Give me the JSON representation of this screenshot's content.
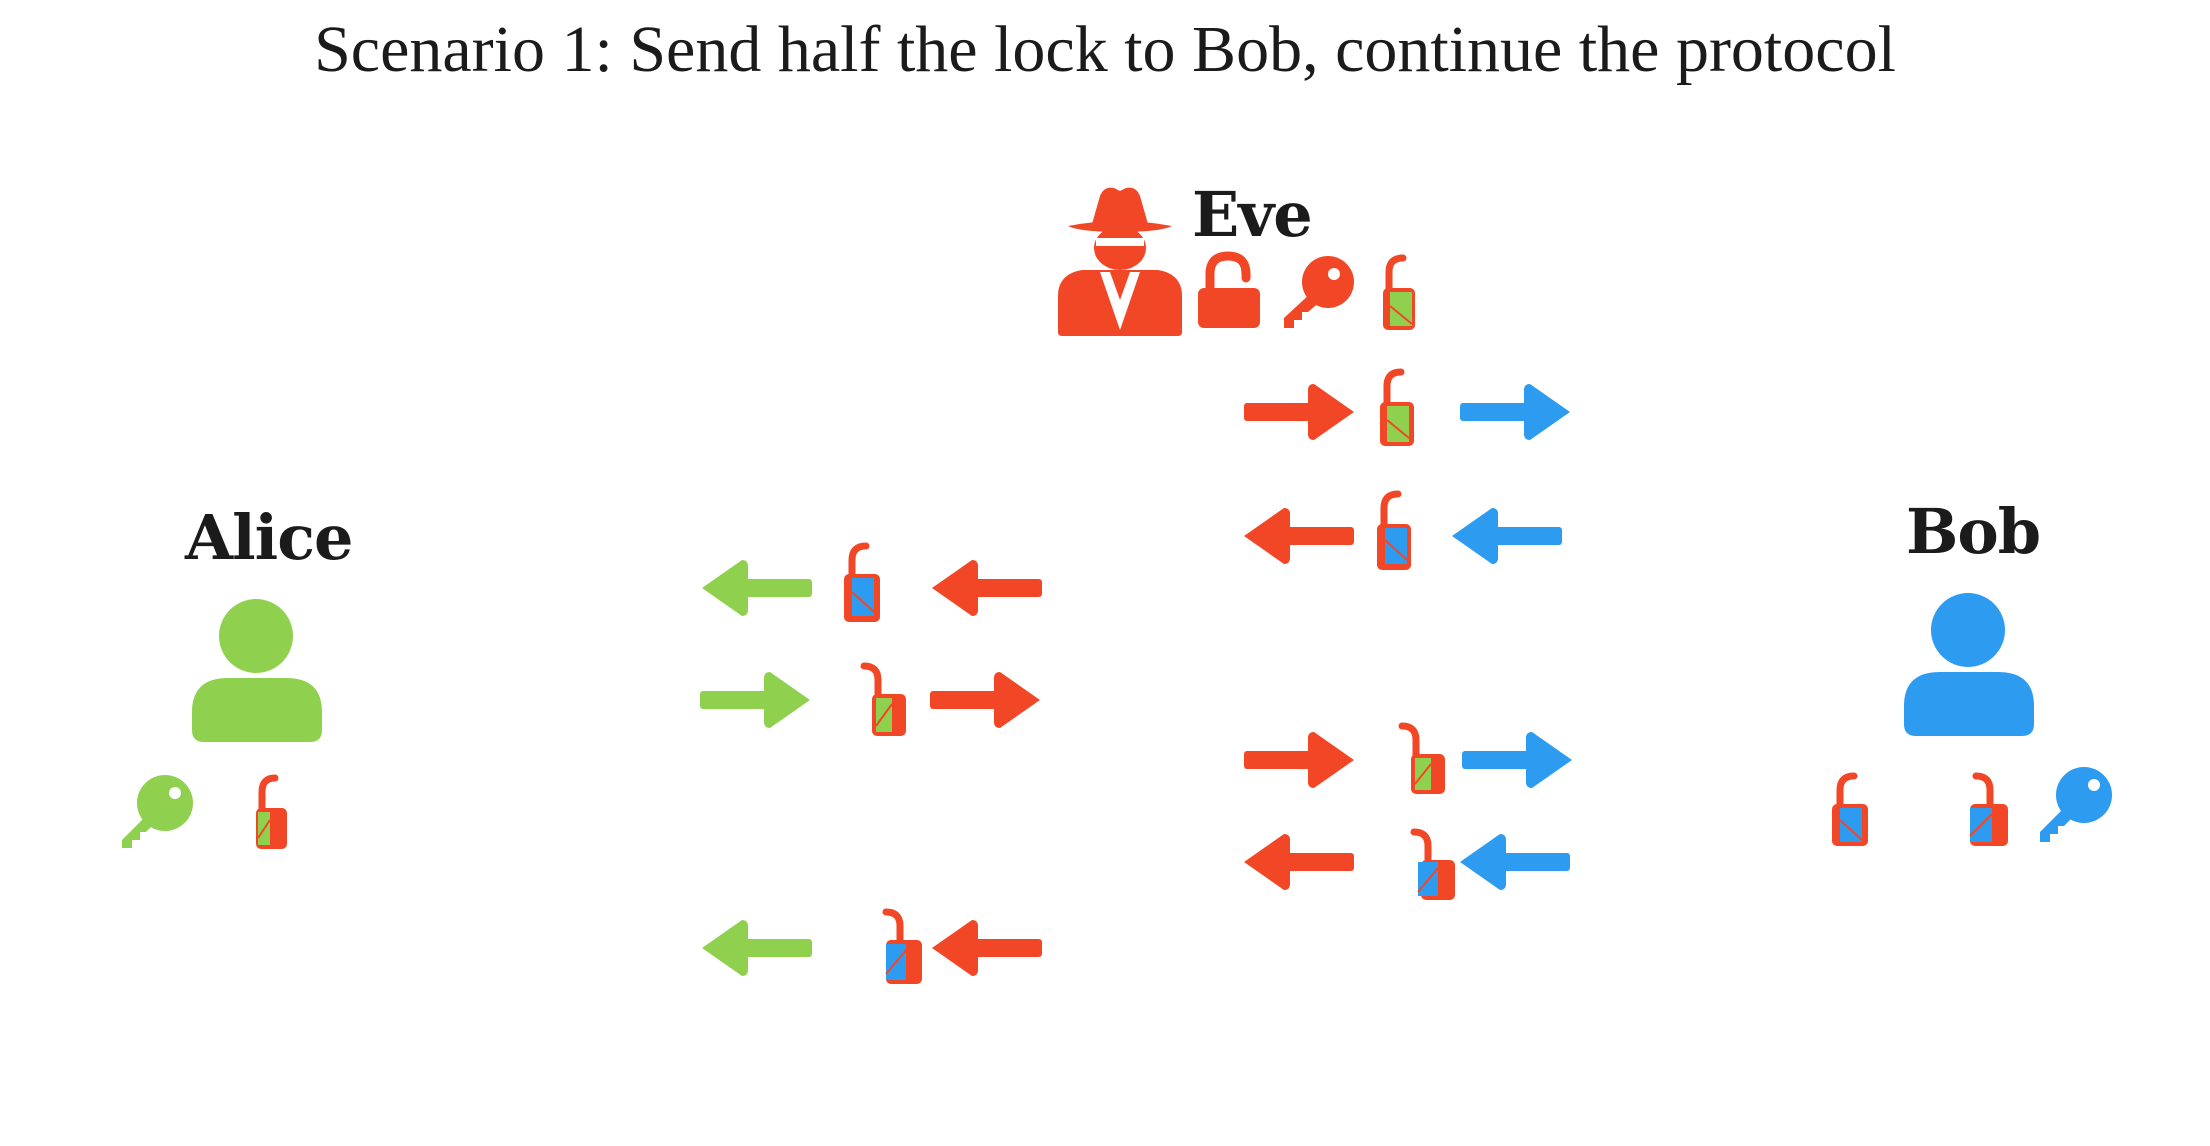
{
  "title": "Scenario 1: Send half the lock to Bob, continue the protocol",
  "actors": {
    "alice": {
      "name": "Alice"
    },
    "eve": {
      "name": "Eve"
    },
    "bob": {
      "name": "Bob"
    }
  },
  "colors": {
    "alice": "#8fd14f",
    "eve": "#f24726",
    "bob": "#2d9bf0",
    "text": "#1b1b1b"
  },
  "icons": {
    "person": "person-icon",
    "spy": "spy-icon",
    "key": "key-icon",
    "lock": "padlock-icon",
    "arrow": "arrow-icon"
  }
}
